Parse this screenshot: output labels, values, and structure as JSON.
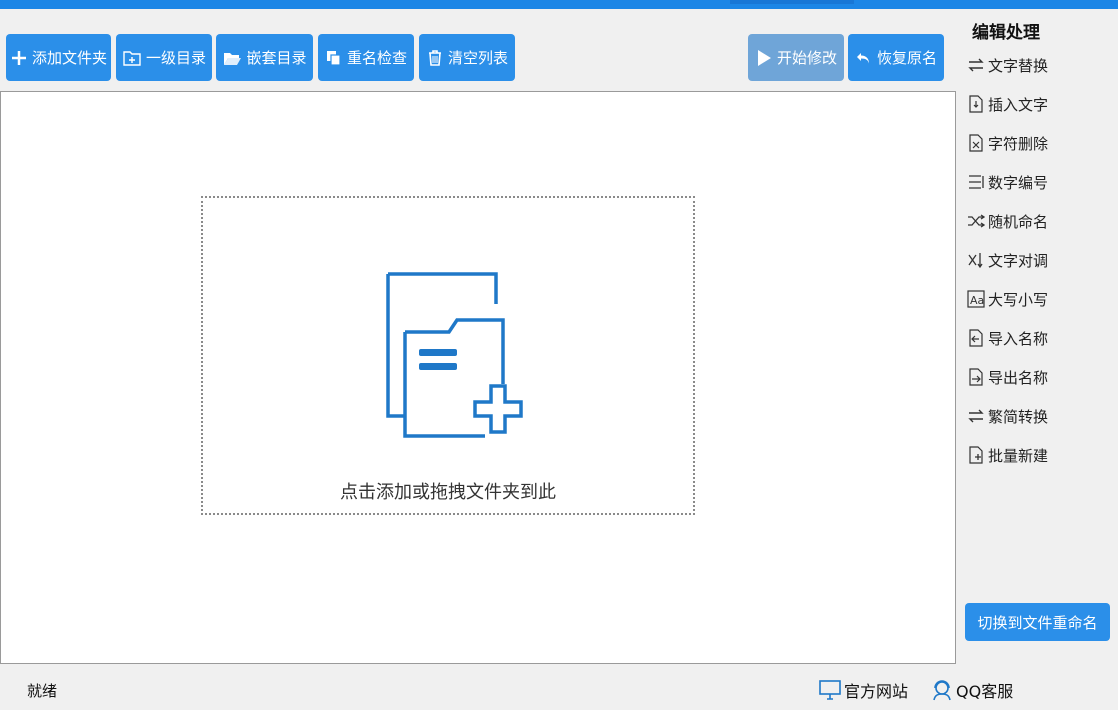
{
  "toolbar": {
    "add_folder": "添加文件夹",
    "level_one": "一级目录",
    "nested": "嵌套目录",
    "dup_check": "重名检查",
    "clear_list": "清空列表",
    "start_modify": "开始修改",
    "restore": "恢复原名"
  },
  "dropzone": {
    "hint": "点击添加或拖拽文件夹到此"
  },
  "sidebar": {
    "title": "编辑处理",
    "items": [
      {
        "label": "文字替换",
        "icon": "swap-icon"
      },
      {
        "label": "插入文字",
        "icon": "insert-doc-icon"
      },
      {
        "label": "字符删除",
        "icon": "delete-doc-icon"
      },
      {
        "label": "数字编号",
        "icon": "numbering-icon"
      },
      {
        "label": "随机命名",
        "icon": "shuffle-icon"
      },
      {
        "label": "文字对调",
        "icon": "exchange-icon"
      },
      {
        "label": "大写小写",
        "icon": "case-icon"
      },
      {
        "label": "导入名称",
        "icon": "import-icon"
      },
      {
        "label": "导出名称",
        "icon": "export-icon"
      },
      {
        "label": "繁简转换",
        "icon": "convert-icon"
      },
      {
        "label": "批量新建",
        "icon": "new-doc-icon"
      }
    ],
    "switch_button": "切换到文件重命名"
  },
  "status": {
    "text": "就绪",
    "website": "官方网站",
    "qq": "QQ客服"
  },
  "colors": {
    "accent": "#2b8fe9",
    "disabled": "#6fa5d8",
    "icon_blue": "#1f78c8"
  }
}
